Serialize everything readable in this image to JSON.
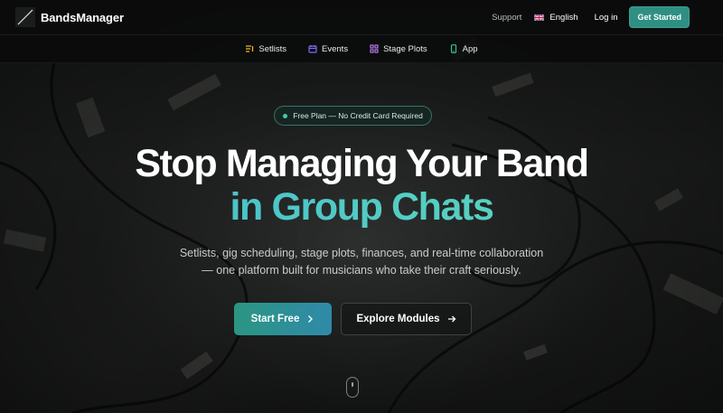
{
  "brand": {
    "name": "BandsManager",
    "icon": "logo-slash-mark"
  },
  "topnav": {
    "support": "Support",
    "language": "English",
    "language_icon": "uk-flag-icon",
    "login": "Log in",
    "get_started": "Get Started"
  },
  "subnav": [
    {
      "label": "Setlists",
      "icon": "setlist-icon"
    },
    {
      "label": "Events",
      "icon": "calendar-icon"
    },
    {
      "label": "Stage Plots",
      "icon": "grid-icon"
    },
    {
      "label": "App",
      "icon": "phone-icon"
    }
  ],
  "hero": {
    "badge": "Free Plan — No Credit Card Required",
    "title_line1": "Stop Managing Your Band",
    "title_line2": "in Group Chats",
    "subtitle_line1": "Setlists, gig scheduling, stage plots, finances, and real-time collaboration",
    "subtitle_line2": "— one platform built for musicians who take their craft seriously.",
    "primary_cta": "Start Free",
    "secondary_cta": "Explore Modules"
  },
  "colors": {
    "accent": "#2f8f82",
    "gradient_start": "#3fb8cf",
    "gradient_end": "#5fd2b5",
    "setlist_icon": "#f0b429",
    "events_icon": "#7b6cf6",
    "stageplots_icon": "#c77dff",
    "app_icon": "#35c2a2"
  }
}
